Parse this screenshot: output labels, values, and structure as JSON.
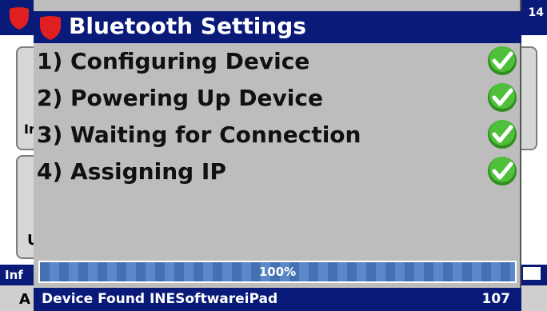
{
  "background": {
    "clock_fragment": "14",
    "left_label_fragment_1": "Ir",
    "left_label_fragment_2": "U",
    "status_fragment": "Inf",
    "bottom_fragment": "A"
  },
  "dialog": {
    "title": "Bluetooth Settings",
    "steps": [
      {
        "label": "1) Configuring Device",
        "icon": "check-icon"
      },
      {
        "label": "2) Powering Up Device",
        "icon": "check-icon"
      },
      {
        "label": "3) Waiting for Connection",
        "icon": "check-icon"
      },
      {
        "label": "4) Assigning IP",
        "icon": "check-icon"
      }
    ],
    "progress": {
      "value": 1.0,
      "text": "100%"
    },
    "status_text": "Device Found INESoftwareiPad",
    "status_number": "107"
  },
  "colors": {
    "title_bar": "#0a1a78",
    "dialog_bg": "#bdbdbd",
    "check_green": "#3fae2a",
    "shield_red": "#e02020"
  }
}
